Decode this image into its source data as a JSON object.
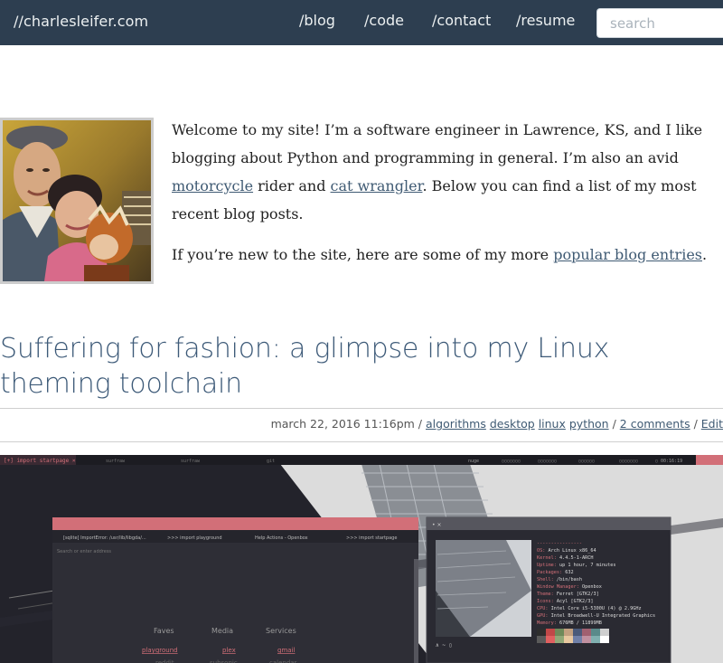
{
  "navbar": {
    "brand": "//charlesleifer.com",
    "links": [
      "/blog",
      "/code",
      "/contact",
      "/resume"
    ],
    "search_placeholder": "search"
  },
  "intro": {
    "p1_before": "Welcome to my site! I’m a software engineer in Lawrence, KS, and I like blogging about Python and programming in general. I’m also an avid ",
    "link_motorcycle": "motorcycle",
    "p1_mid": " rider and ",
    "link_cat": "cat wrangler",
    "p1_after": ". Below you can find a list of my most recent blog posts.",
    "p2_before": "If you’re new to the site, here are some of my more ",
    "link_popular": "popular blog entries",
    "p2_after": "."
  },
  "post": {
    "title": "Suffering for fashion: a glimpse into my Linux theming toolchain",
    "date": "march 22, 2016 11:16pm",
    "sep": " / ",
    "tags": [
      "algorithms",
      "desktop",
      "linux",
      "python"
    ],
    "comments": "2 comments",
    "edit": "Edit"
  },
  "screenshot": {
    "topbar_left": "[+] import startpage ×",
    "topbar_items": [
      "surfraw",
      "surfraw",
      "git",
      "nuge",
      "▯▯▯▯▯▯▯",
      "▯▯▯▯▯▯▯",
      "▯▯▯▯▯▯",
      "▯▯▯▯▯▯▯",
      "▯ 00:16:19"
    ],
    "browser": {
      "tab1": "[sqlite] ImportError: /usr/lib/libgda/...",
      "tab2": ">>> import playground",
      "tab3": "Help Actions - Openbox",
      "tab4": ">>> import startpage",
      "address_placeholder": "Search or enter address",
      "columns": [
        "Faves",
        "Media",
        "Services"
      ],
      "row1": [
        "playground",
        "plex",
        "gmail"
      ],
      "row2": [
        "reddit",
        "subsonic",
        "calendar"
      ]
    },
    "terminal": {
      "title": "• ×",
      "info": [
        [
          "----------------",
          ""
        ],
        [
          "OS: ",
          "Arch Linux x86_64"
        ],
        [
          "Kernel: ",
          "4.4.5-1-ARCH"
        ],
        [
          "Uptime: ",
          "up 1 hour, 7 minutes"
        ],
        [
          "Packages: ",
          "632"
        ],
        [
          "Shell: ",
          "/bin/bash"
        ],
        [
          "Window Manager: ",
          "Openbox"
        ],
        [
          "Theme: ",
          "Ferret [GTK2/3]"
        ],
        [
          "Icons: ",
          "Acyl [GTK2/3]"
        ],
        [
          "CPU: ",
          "Intel Core i5-5300U (4) @ 2.9GHz"
        ],
        [
          "GPU: ",
          "Intel Broadwell-U Integrated Graphics"
        ],
        [
          "Memory: ",
          "676MB / 11899MB"
        ]
      ],
      "prompt": "∧ ~ ▯"
    },
    "swatches": [
      "#2d2d2d",
      "#c04848",
      "#6e8a5a",
      "#c2a080",
      "#4a5a7a",
      "#a06070",
      "#5a8a8a",
      "#cfcfcf",
      "#5a5a5a",
      "#e06060",
      "#90a878",
      "#e8c8a0",
      "#7080a8",
      "#c090a0",
      "#80b0b0",
      "#ffffff"
    ]
  },
  "colors": {
    "navbar_bg": "#2d3e50",
    "link": "#3f5a73",
    "title": "#3d5a78",
    "accent_pink": "#d26f78"
  }
}
